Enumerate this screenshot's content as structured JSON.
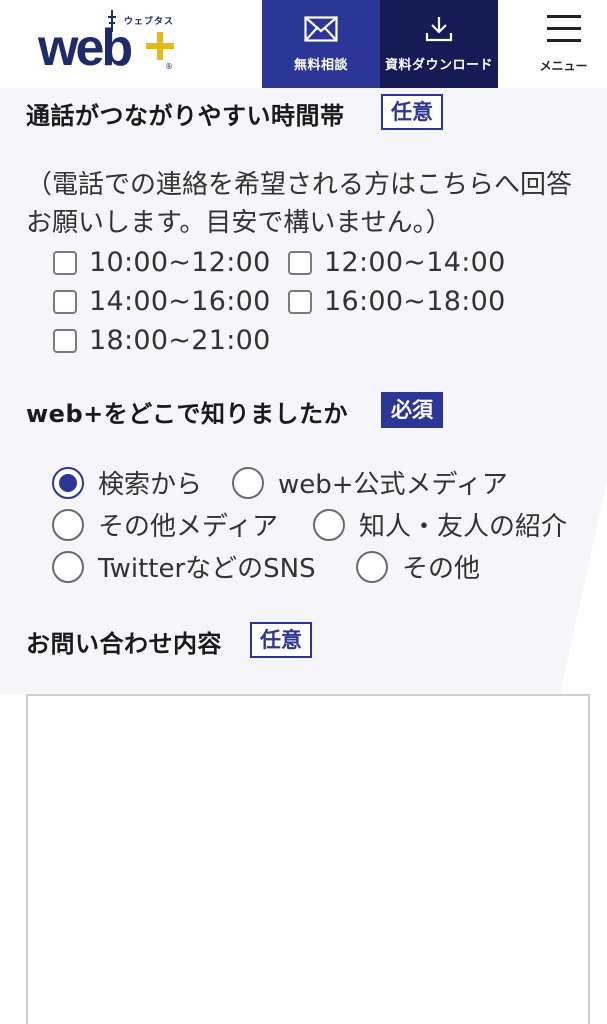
{
  "header": {
    "logo": {
      "sub": "ウェブタス",
      "main": "web"
    },
    "consult_label": "無料相談",
    "download_label": "資料ダウンロード",
    "menu_label": "メニュー"
  },
  "form": {
    "call_time": {
      "title": "通話がつながりやすい時間帯",
      "badge": "任意",
      "note": "（電話での連絡を希望される方はこちらへ回答お願いします。目安で構いません。）",
      "options": [
        "10:00~12:00",
        "12:00~14:00",
        "14:00~16:00",
        "16:00~18:00",
        "18:00~21:00"
      ]
    },
    "source": {
      "title": "web+をどこで知りましたか",
      "badge": "必須",
      "options": [
        "検索から",
        "web+公式メディア",
        "その他メディア",
        "知人・友人の紹介",
        "TwitterなどのSNS",
        "その他"
      ],
      "selected": "検索から"
    },
    "inquiry": {
      "title": "お問い合わせ内容",
      "badge": "任意",
      "value": ""
    }
  },
  "colors": {
    "accent": "#2b3696",
    "dark_accent": "#161a55",
    "logo_yellow": "#e5b820",
    "form_bg": "#f5f5fa"
  },
  "icons": {
    "consult": "mail-icon",
    "download": "download-icon",
    "menu": "hamburger-icon"
  }
}
